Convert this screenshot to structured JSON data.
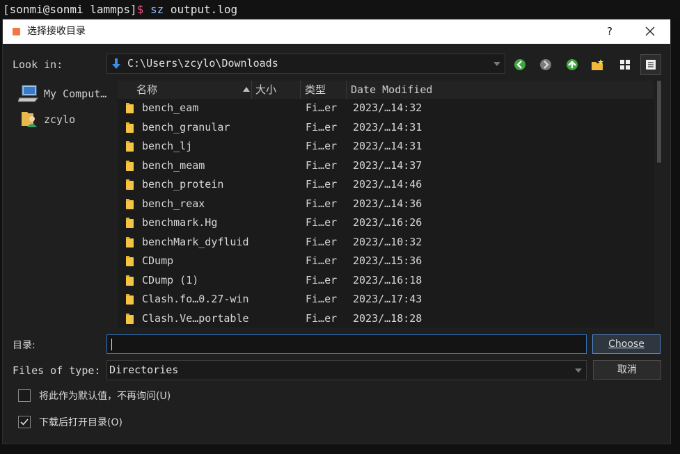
{
  "terminal": {
    "prompt": "[sonmi@sonmi lammps]",
    "dollar": "$",
    "command": "sz",
    "argument": "output.log"
  },
  "dialog": {
    "title": "选择接收目录",
    "help": "?",
    "look_in_label": "Look in:",
    "path": "C:\\Users\\zcylo\\Downloads",
    "toolbar_icons": [
      "back-icon",
      "forward-icon",
      "up-icon",
      "new-folder-icon",
      "list-view-icon",
      "detail-view-icon"
    ],
    "sidebar": [
      {
        "label": "My Comput…",
        "icon": "computer-icon"
      },
      {
        "label": "zcylo",
        "icon": "user-folder-icon"
      }
    ],
    "columns": {
      "name": "名称",
      "size": "大小",
      "type": "类型",
      "modified": "Date Modified"
    },
    "files": [
      {
        "name": "bench_eam",
        "type": "Fi…er",
        "date": "2023/…14:32"
      },
      {
        "name": "bench_granular",
        "type": "Fi…er",
        "date": "2023/…14:31"
      },
      {
        "name": "bench_lj",
        "type": "Fi…er",
        "date": "2023/…14:31"
      },
      {
        "name": "bench_meam",
        "type": "Fi…er",
        "date": "2023/…14:37"
      },
      {
        "name": "bench_protein",
        "type": "Fi…er",
        "date": "2023/…14:46"
      },
      {
        "name": "bench_reax",
        "type": "Fi…er",
        "date": "2023/…14:36"
      },
      {
        "name": "benchmark.Hg",
        "type": "Fi…er",
        "date": "2023/…16:26"
      },
      {
        "name": "benchMark_dyfluid",
        "type": "Fi…er",
        "date": "2023/…10:32"
      },
      {
        "name": "CDump",
        "type": "Fi…er",
        "date": "2023/…15:36"
      },
      {
        "name": "CDump (1)",
        "type": "Fi…er",
        "date": "2023/…16:18"
      },
      {
        "name": "Clash.fo…0.27-win",
        "type": "Fi…er",
        "date": "2023/…17:43"
      },
      {
        "name": "Clash.Ve…portable",
        "type": "Fi…er",
        "date": "2023/…18:28"
      }
    ],
    "dir_label": "目录:",
    "dir_value": "",
    "choose_button": "Choose",
    "file_type_label": "Files of type:",
    "file_type_value": "Directories",
    "cancel_button": "取消",
    "checkbox_default": {
      "label": "将此作为默认值，不再询问(U)",
      "checked": false
    },
    "checkbox_open": {
      "label": "下载后打开目录(O)",
      "checked": true
    }
  }
}
